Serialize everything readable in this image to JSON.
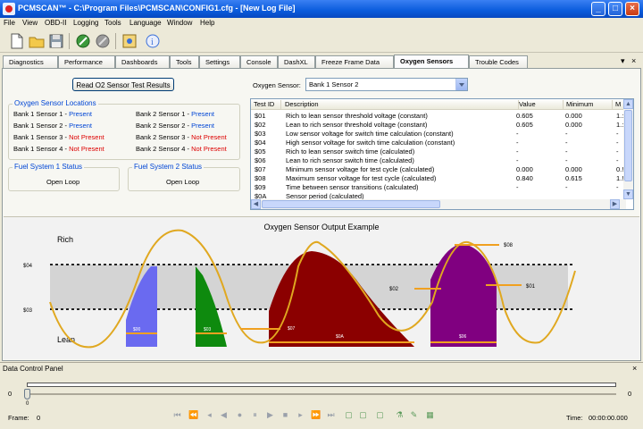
{
  "window": {
    "title": "PCMSCAN™ - C:\\Program Files\\PCMSCAN\\CONFIG1.cfg - [New Log File]",
    "buttons": {
      "minimize": "_",
      "maximize": "□",
      "close": "×"
    }
  },
  "menu": [
    "File",
    "View",
    "OBD-II",
    "Logging",
    "Tools",
    "Language",
    "Window",
    "Help"
  ],
  "toolbar": {
    "icons": [
      "new-file-icon",
      "open-folder-icon",
      "save-disk-icon",
      "connect-icon",
      "disconnect-icon",
      "settings-icon",
      "about-icon"
    ]
  },
  "tabs": [
    {
      "label": "Diagnostics",
      "active": false
    },
    {
      "label": "Performance",
      "active": false
    },
    {
      "label": "Dashboards",
      "active": false
    },
    {
      "label": "Tools",
      "active": false
    },
    {
      "label": "Settings",
      "active": false
    },
    {
      "label": "Console",
      "active": false
    },
    {
      "label": "DashXL",
      "active": false
    },
    {
      "label": "Freeze Frame Data",
      "active": false
    },
    {
      "label": "Oxygen Sensors",
      "active": true
    },
    {
      "label": "Trouble Codes",
      "active": false
    }
  ],
  "tabstrip_controls": {
    "menu": "▾",
    "close": "×"
  },
  "read_button": "Read O2 Sensor Test Results",
  "sensor_locations": {
    "title": "Oxygen Sensor Locations",
    "bank1": [
      {
        "name": "Bank 1 Sensor 1",
        "status": "Present",
        "present": true
      },
      {
        "name": "Bank 1 Sensor 2",
        "status": "Present",
        "present": true
      },
      {
        "name": "Bank 1 Sensor 3",
        "status": "Not Present",
        "present": false
      },
      {
        "name": "Bank 1 Sensor 4",
        "status": "Not Present",
        "present": false
      }
    ],
    "bank2": [
      {
        "name": "Bank 2 Sensor 1",
        "status": "Present",
        "present": true
      },
      {
        "name": "Bank 2 Sensor 2",
        "status": "Present",
        "present": true
      },
      {
        "name": "Bank 2 Sensor 3",
        "status": "Not Present",
        "present": false
      },
      {
        "name": "Bank 2 Sensor 4",
        "status": "Not Present",
        "present": false
      }
    ],
    "separator": " - "
  },
  "fuel_system_1": {
    "title": "Fuel System 1 Status",
    "value": "Open Loop"
  },
  "fuel_system_2": {
    "title": "Fuel System 2 Status",
    "value": "Open Loop"
  },
  "sensor_select": {
    "label": "Oxygen Sensor:",
    "value": "Bank 1 Sensor 2"
  },
  "table": {
    "columns": [
      "Test ID",
      "Description",
      "Value",
      "Minimum",
      "M"
    ],
    "rows": [
      [
        "$01",
        "Rich to lean sensor threshold voltage (constant)",
        "0.605",
        "0.000",
        "1.:"
      ],
      [
        "$02",
        "Lean to rich sensor threshold voltage (constant)",
        "0.605",
        "0.000",
        "1.:"
      ],
      [
        "$03",
        "Low sensor voltage for switch time calculation (constant)",
        "-",
        "-",
        "-"
      ],
      [
        "$04",
        "High sensor voltage for switch time calculation (constant)",
        "-",
        "-",
        "-"
      ],
      [
        "$05",
        "Rich to lean sensor switch time (calculated)",
        "-",
        "-",
        "-"
      ],
      [
        "$06",
        "Lean to rich sensor switch time (calculated)",
        "-",
        "-",
        "-"
      ],
      [
        "$07",
        "Minimum sensor voltage for test cycle (calculated)",
        "0.000",
        "0.000",
        "0.!"
      ],
      [
        "$08",
        "Maximum sensor voltage for test cycle (calculated)",
        "0.840",
        "0.615",
        "1.!"
      ],
      [
        "$09",
        "Time between sensor transitions (calculated)",
        "-",
        "-",
        "-"
      ],
      [
        "$0A",
        "Sensor period (calculated)",
        "",
        "",
        ""
      ]
    ]
  },
  "chart": {
    "title": "Oxygen Sensor Output Example",
    "rich_label": "Rich",
    "lean_label": "Lean",
    "threshold_labels": {
      "s04": "$04",
      "s03": "$03"
    },
    "marker_labels": [
      "$00",
      "$03",
      "$07",
      "$0A",
      "$02",
      "$08",
      "$01",
      "$06"
    ]
  },
  "data_control_panel": {
    "title": "Data Control Panel",
    "close": "×",
    "slider_min": "0",
    "slider_max": "0",
    "slider_start": "0",
    "frame_label": "Frame:",
    "frame_value": "0",
    "time_label": "Time:",
    "time_value": "00:00:00.000",
    "transport": [
      "first-icon",
      "prev-fast-icon",
      "step-back-icon",
      "back-icon",
      "record-icon",
      "pause-icon",
      "play-icon",
      "stop-icon",
      "forward-icon",
      "fast-forward-icon",
      "last-icon",
      "new-log-icon",
      "open-log-icon",
      "save-log-icon",
      "filter-icon",
      "tag-icon",
      "grid-icon"
    ]
  }
}
